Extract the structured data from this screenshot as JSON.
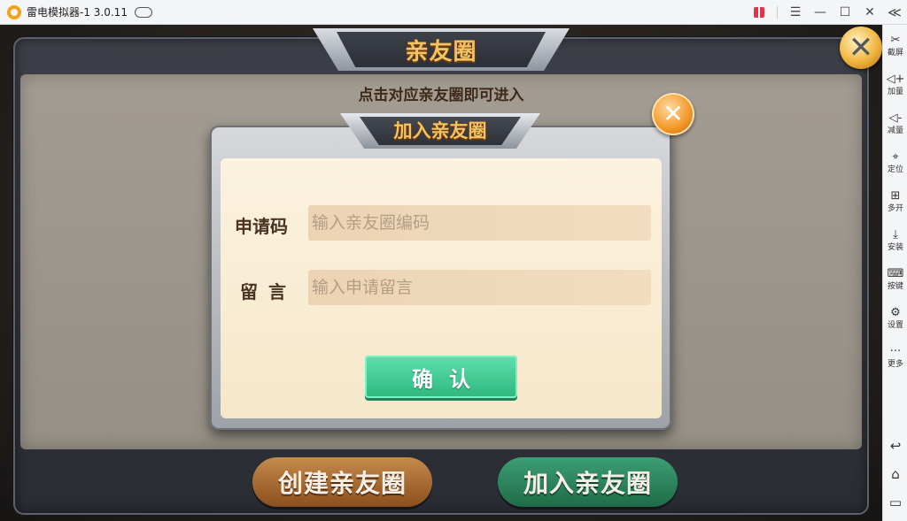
{
  "emulator": {
    "title": "雷电模拟器-1 3.0.11",
    "controls": {
      "menu": "☰",
      "minimize": "—",
      "maximize": "☐",
      "close": "✕",
      "collapse": "≪"
    }
  },
  "sidebar": {
    "items": [
      {
        "label": "截屏",
        "icon": "scissors-icon",
        "glyph": "✂"
      },
      {
        "label": "加量",
        "icon": "volume-up-icon",
        "glyph": "◁+"
      },
      {
        "label": "减量",
        "icon": "volume-down-icon",
        "glyph": "◁-"
      },
      {
        "label": "定位",
        "icon": "location-pin-icon",
        "glyph": "⌖"
      },
      {
        "label": "多开",
        "icon": "multi-instance-icon",
        "glyph": "⊞"
      },
      {
        "label": "安装",
        "icon": "apk-install-icon",
        "glyph": "⤓"
      },
      {
        "label": "按键",
        "icon": "keyboard-icon",
        "glyph": "⌨"
      },
      {
        "label": "设置",
        "icon": "gear-icon",
        "glyph": "⚙"
      },
      {
        "label": "更多",
        "icon": "more-dots-icon",
        "glyph": "···"
      }
    ],
    "nav": {
      "back": "↩",
      "home": "⌂",
      "recents": "▭"
    }
  },
  "game": {
    "header_title": "亲友圈",
    "hint": "点击对应亲友圈即可进入",
    "close_glyph": "✕",
    "create_button": "创建亲友圈",
    "join_button": "加入亲友圈"
  },
  "dialog": {
    "title": "加入亲友圈",
    "close_glyph": "✕",
    "code_label": "申请码",
    "code_placeholder": "输入亲友圈编码",
    "code_value": "",
    "message_label": "留言",
    "message_placeholder": "输入申请留言",
    "message_value": "",
    "confirm_label": "确认"
  },
  "colors": {
    "gold_title": "#f2c265",
    "confirm_green": "#2fb77f",
    "create_brown": "#8a4f1d",
    "join_green": "#1e6b48",
    "close_orange": "#f29a2a"
  }
}
